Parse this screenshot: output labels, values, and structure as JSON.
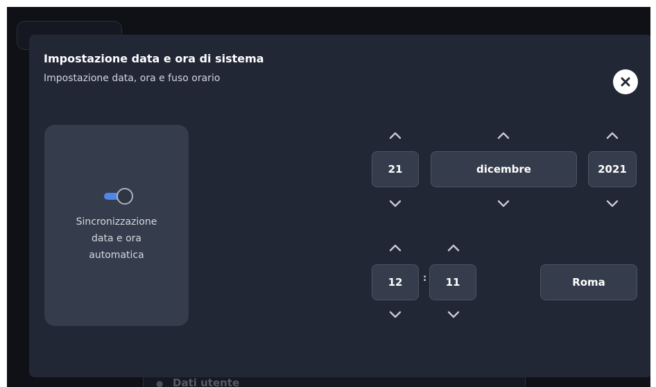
{
  "modal": {
    "title": "Impostazione data e ora di sistema",
    "subtitle": "Impostazione data, ora e fuso orario"
  },
  "sync": {
    "enabled": true,
    "label_lines": [
      "Sincronizzazione",
      "data e ora",
      "automatica"
    ]
  },
  "date": {
    "day": "21",
    "month": "dicembre",
    "year": "2021"
  },
  "time": {
    "hour": "12",
    "separator": ":",
    "minute": "11"
  },
  "timezone": {
    "value": "Roma"
  },
  "background": {
    "footer_label": "Dati utente"
  },
  "colors": {
    "accent": "#4f86ea",
    "panel": "#222736",
    "card": "#353c4b"
  },
  "icons": {
    "close": "close-icon",
    "up": "chevron-up-icon",
    "down": "chevron-down-icon"
  }
}
